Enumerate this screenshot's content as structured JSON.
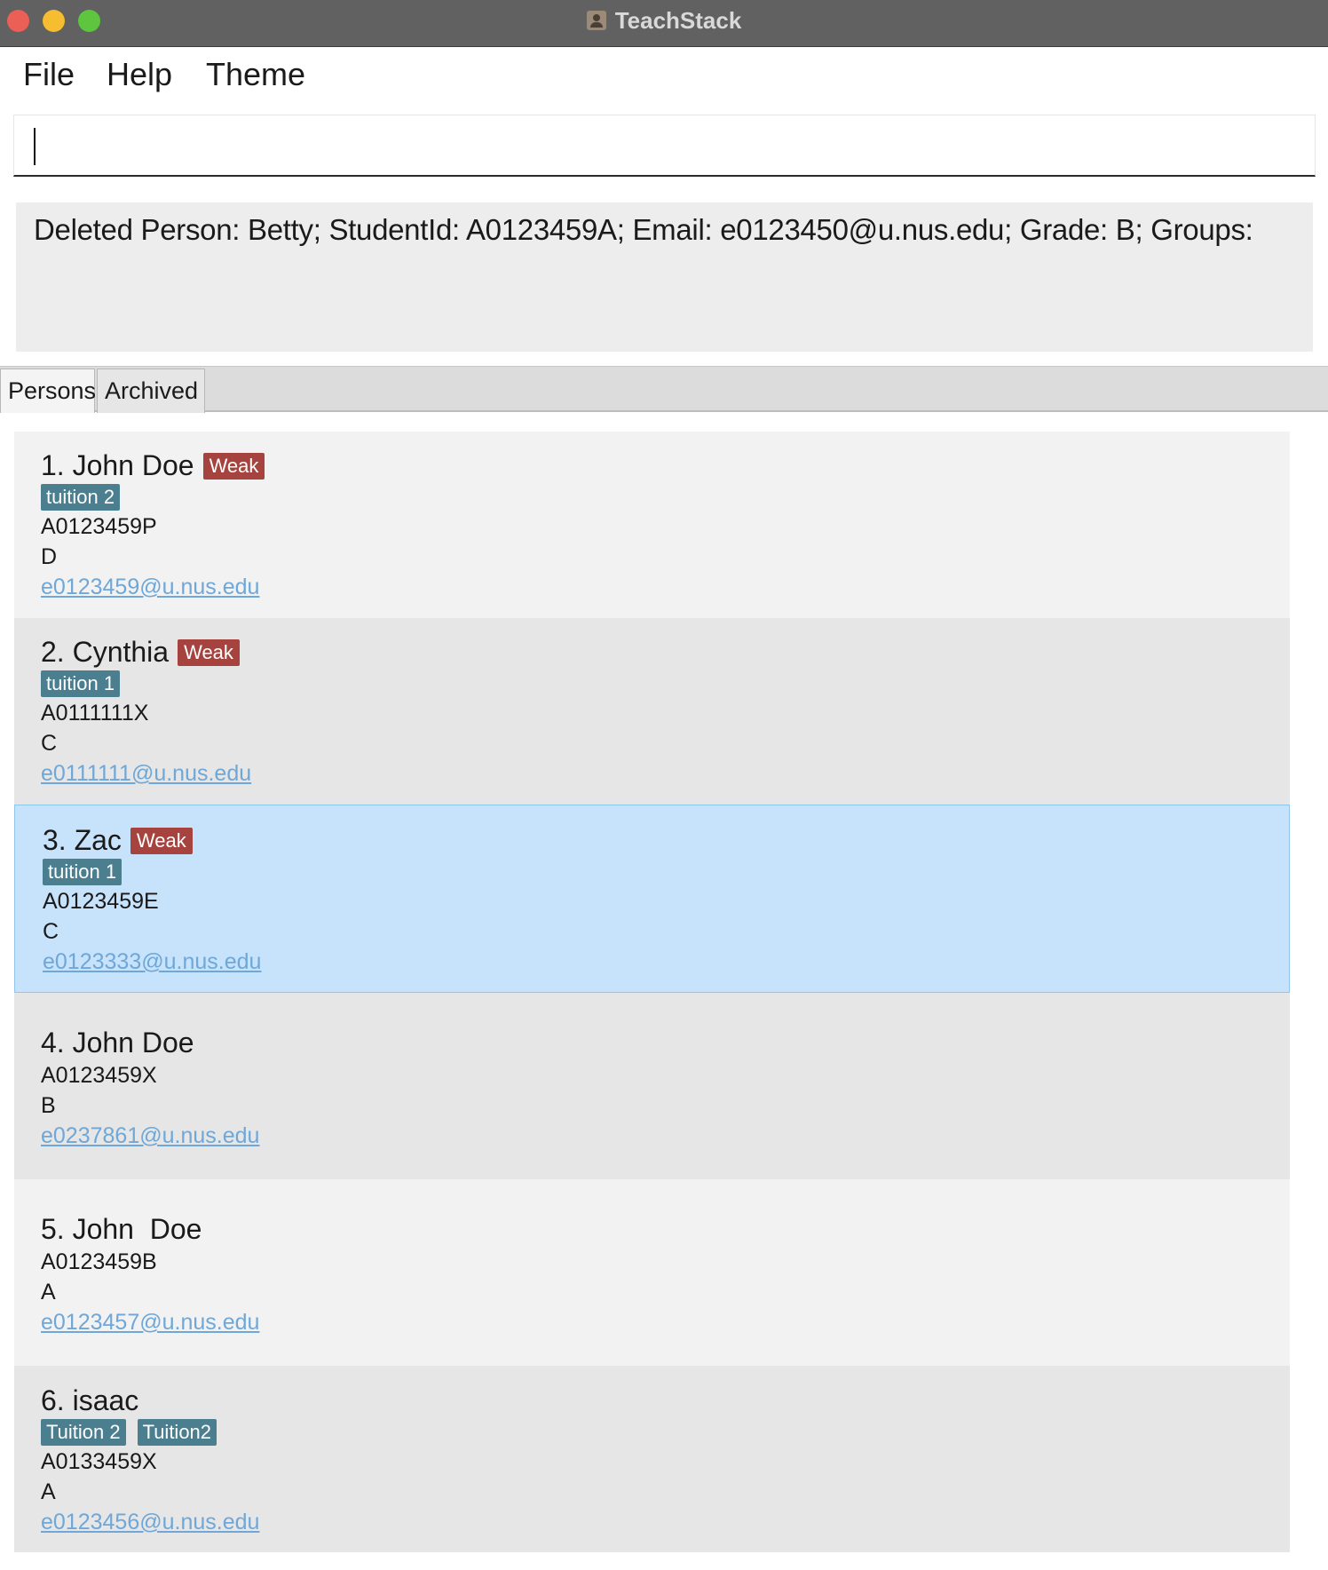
{
  "window": {
    "title": "TeachStack"
  },
  "menu": {
    "file": "File",
    "help": "Help",
    "theme": "Theme"
  },
  "command": {
    "value": ""
  },
  "result": {
    "text": "Deleted Person: Betty; StudentId: A0123459A; Email: e0123450@u.nus.edu; Grade: B; Groups:"
  },
  "tabs": [
    {
      "label": "Persons"
    },
    {
      "label": "Archived"
    }
  ],
  "persons": [
    {
      "index": "1.",
      "name": "John Doe",
      "badge": "Weak",
      "tags": [
        "tuition 2"
      ],
      "student_id": "A0123459P",
      "grade": "D",
      "email": "e0123459@u.nus.edu"
    },
    {
      "index": "2.",
      "name": "Cynthia",
      "badge": "Weak",
      "tags": [
        "tuition 1"
      ],
      "student_id": "A0111111X",
      "grade": "C",
      "email": "e0111111@u.nus.edu"
    },
    {
      "index": "3.",
      "name": "Zac",
      "badge": "Weak",
      "tags": [
        "tuition 1"
      ],
      "student_id": "A0123459E",
      "grade": "C",
      "email": "e0123333@u.nus.edu"
    },
    {
      "index": "4.",
      "name": "John Doe",
      "student_id": "A0123459X",
      "grade": "B",
      "email": "e0237861@u.nus.edu"
    },
    {
      "index": "5.",
      "name": "John  Doe",
      "student_id": "A0123459B",
      "grade": "A",
      "email": "e0123457@u.nus.edu"
    },
    {
      "index": "6.",
      "name": "isaac",
      "tags": [
        "Tuition 2",
        "Tuition2"
      ],
      "student_id": "A0133459X",
      "grade": "A",
      "email": "e0123456@u.nus.edu"
    }
  ]
}
